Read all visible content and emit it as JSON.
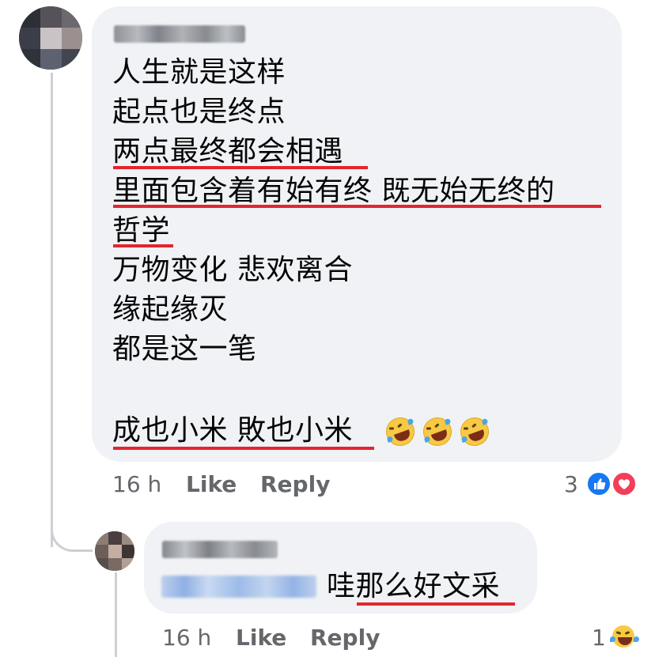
{
  "comments": [
    {
      "lines": [
        "人生就是这样",
        "起点也是终点",
        "两点最终都会相遇",
        "里面包含着有始有终 既无始无终的",
        "哲学",
        "万物变化 悲欢离合",
        "缘起缘灭",
        "都是这一笔",
        "成也小米 敗也小米"
      ],
      "emoji": [
        "rolling-on-floor-laughing",
        "rolling-on-floor-laughing",
        "rolling-on-floor-laughing"
      ],
      "time": "16 h",
      "like_label": "Like",
      "reply_label": "Reply",
      "reaction_count": "3",
      "reaction_icons": [
        "like-reaction",
        "love-reaction"
      ]
    }
  ],
  "reply": {
    "text": "哇那么好文采",
    "time": "16 h",
    "like_label": "Like",
    "reply_label": "Reply",
    "reaction_count": "1",
    "reaction_icons": [
      "laughing-reaction"
    ]
  },
  "colors": {
    "bubble": "#f0f2f5",
    "underline": "#e4252c",
    "meta_text": "#65676b",
    "like_blue": "#1877f2",
    "love_red": "#f33e58"
  }
}
